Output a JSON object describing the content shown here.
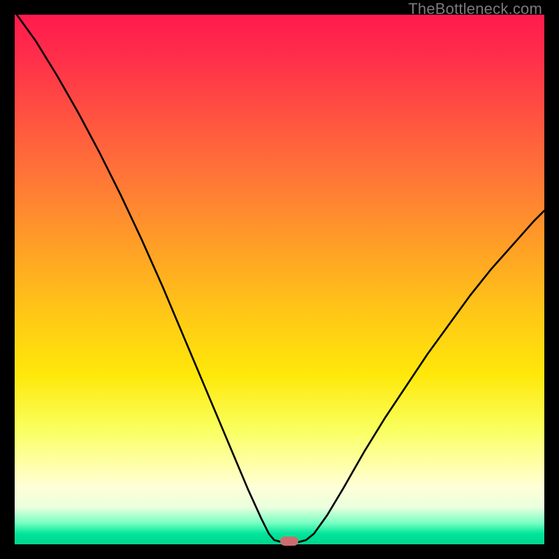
{
  "attribution": "TheBottleneck.com",
  "colors": {
    "background": "#000000",
    "curve": "#000000",
    "marker": "#cf6b6e",
    "attribution_text": "#7b7b7b"
  },
  "chart_data": {
    "type": "line",
    "title": "",
    "xlabel": "",
    "ylabel": "",
    "xlim": [
      0,
      100
    ],
    "ylim": [
      0,
      100
    ],
    "grid": false,
    "curve_xy": [
      [
        0.4,
        100.0
      ],
      [
        4.0,
        95.0
      ],
      [
        8.0,
        88.5
      ],
      [
        12.0,
        81.5
      ],
      [
        16.0,
        74.0
      ],
      [
        20.0,
        66.0
      ],
      [
        24.0,
        57.5
      ],
      [
        28.0,
        48.5
      ],
      [
        32.0,
        39.0
      ],
      [
        36.0,
        29.5
      ],
      [
        40.0,
        20.0
      ],
      [
        44.0,
        10.5
      ],
      [
        46.5,
        5.0
      ],
      [
        48.0,
        2.0
      ],
      [
        49.0,
        0.8
      ],
      [
        50.5,
        0.4
      ],
      [
        53.5,
        0.4
      ],
      [
        55.0,
        0.8
      ],
      [
        56.5,
        2.0
      ],
      [
        59.0,
        5.5
      ],
      [
        62.0,
        10.5
      ],
      [
        66.0,
        17.5
      ],
      [
        70.0,
        24.0
      ],
      [
        74.0,
        30.0
      ],
      [
        78.0,
        36.0
      ],
      [
        82.0,
        41.5
      ],
      [
        86.0,
        47.0
      ],
      [
        90.0,
        52.0
      ],
      [
        94.0,
        56.5
      ],
      [
        98.0,
        61.0
      ],
      [
        100.0,
        63.0
      ]
    ],
    "marker": {
      "x": 51.8,
      "y": 0.6
    }
  }
}
